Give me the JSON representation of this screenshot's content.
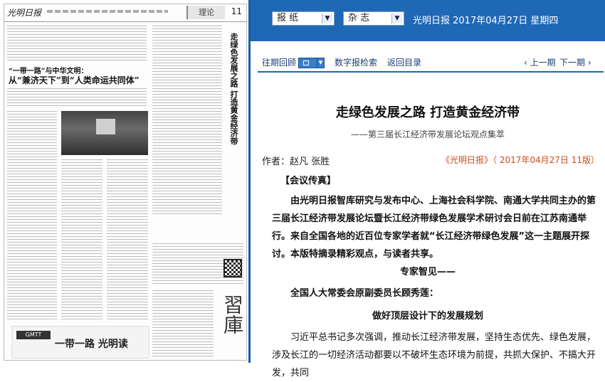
{
  "paper_thumbnail": {
    "logo": "光明日报",
    "section": "理论",
    "page_number": "11",
    "headline_kicker": "“一带一路”与中华文明：",
    "headline": "从“兼济天下”到“人类命运共同体”",
    "vertical_headline": "走绿色发展之路 打造黄金经济带",
    "banner_text": "一带一路 光明读",
    "calligraphy": "習庫"
  },
  "toolbar": {
    "paper_select": "报 纸",
    "magazine_select": "杂 志",
    "date_line": "光明日报 2017年04月27日 星期四"
  },
  "nav": {
    "past_issues": "往期回顾",
    "digital_search": "数字报检索",
    "back_to_index": "返回目录",
    "prev_page": "‹ 上一期",
    "next_page": "下一期 ›"
  },
  "article": {
    "title": "走绿色发展之路 打造黄金经济带",
    "subtitle": "——第三届长江经济带发展论坛观点集萃",
    "author": "作者：赵凡 张胜",
    "source": "《光明日报》（ 2017年04月27日 11版）",
    "section_label": "【会议传真】",
    "lead": "由光明日报智库研究与发布中心、上海社会科学院、南通大学共同主办的第三届长江经济带发展论坛暨长江经济带绿色发展学术研讨会日前在江苏南通举行。来自全国各地的近百位专家学者就“长江经济带绿色发展”这一主题展开探讨。本版特摘录精彩观点，与读者共享。",
    "expert_heading": "专家智见——",
    "speaker": "全国人大常委会原副委员长顾秀莲：",
    "speaker_topic": "做好顶层设计下的发展规划",
    "body_1": "习近平总书记多次强调，推动长江经济带发展，坚持生态优先、绿色发展，涉及长江的一切经济活动都要以不破坏生态环境为前提，共抓大保护、不搞大开发，共同"
  }
}
